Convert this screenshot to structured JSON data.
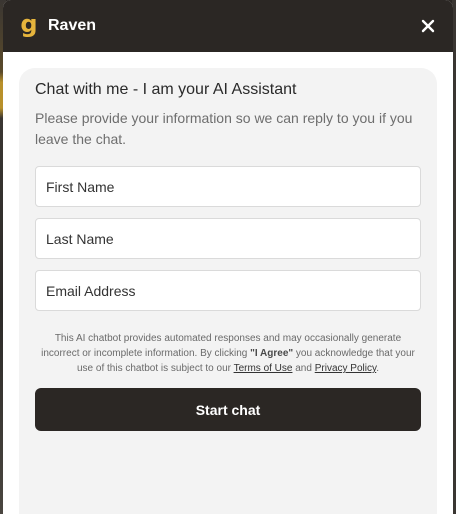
{
  "header": {
    "logo_letter": "g",
    "title": "Raven",
    "close_icon": "close-icon"
  },
  "form": {
    "title": "Chat with me - I am your AI Assistant",
    "subtitle": "Please provide your information so we can reply to you if you leave the chat.",
    "first_name_placeholder": "First Name",
    "last_name_placeholder": "Last Name",
    "email_placeholder": "Email Address"
  },
  "disclaimer": {
    "text_before": "This AI chatbot provides automated responses and may occasionally generate incorrect or incomplete information. By clicking ",
    "agree_text": "\"I Agree\"",
    "text_middle": " you acknowledge that your use of this chatbot is subject to our ",
    "terms_link": "Terms of Use",
    "and_text": " and ",
    "privacy_link": "Privacy Policy",
    "period": "."
  },
  "start_button": {
    "label": "Start chat"
  },
  "colors": {
    "header_bg": "#2b2724",
    "logo_color": "#e6b43c",
    "button_bg": "#2b2724",
    "card_bg": "#f3f3f3"
  }
}
